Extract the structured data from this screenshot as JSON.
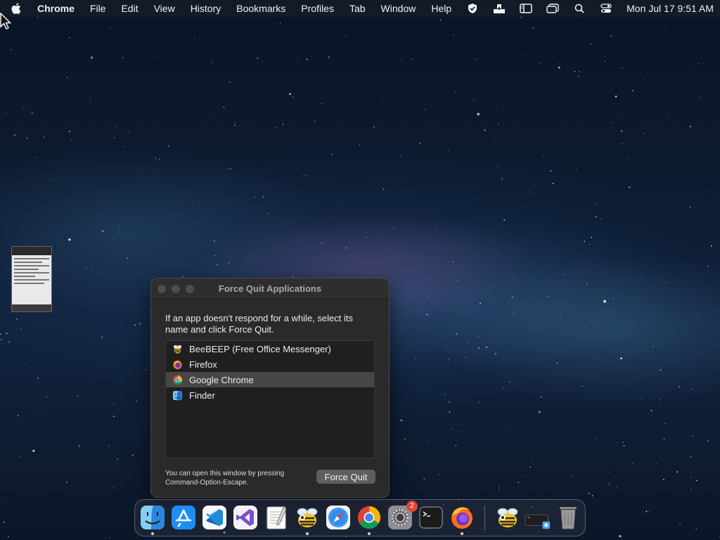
{
  "menubar": {
    "app_name": "Chrome",
    "items": [
      "File",
      "Edit",
      "View",
      "History",
      "Bookmarks",
      "Profiles",
      "Tab",
      "Window",
      "Help"
    ],
    "status_icons": [
      "vpn-shield-icon",
      "share-icon",
      "sidebar-icon",
      "window-overview-icon",
      "search-icon",
      "control-center-icon"
    ],
    "clock": "Mon Jul 17  9:51 AM"
  },
  "force_quit": {
    "title": "Force Quit Applications",
    "intro": "If an app doesn't respond for a while, select its name and click Force Quit.",
    "apps": [
      {
        "name": "BeeBEEP (Free Office Messenger)",
        "icon": "beebeep-icon",
        "selected": false
      },
      {
        "name": "Firefox",
        "icon": "firefox-icon",
        "selected": false
      },
      {
        "name": "Google Chrome",
        "icon": "chrome-icon",
        "selected": true
      },
      {
        "name": "Finder",
        "icon": "finder-icon",
        "selected": false
      }
    ],
    "hint": "You can open this window by pressing Command-Option-Escape.",
    "button": "Force Quit"
  },
  "dock": {
    "apps": [
      {
        "name": "Finder",
        "icon": "finder-icon",
        "running": true
      },
      {
        "name": "App Store",
        "icon": "app-store-icon",
        "running": false
      },
      {
        "name": "Visual Studio Code",
        "icon": "vscode-icon",
        "running": false
      },
      {
        "name": "Visual Studio",
        "icon": "visual-studio-icon",
        "running": false
      },
      {
        "name": "TextEdit",
        "icon": "textedit-icon",
        "running": false
      },
      {
        "name": "BeeBEEP",
        "icon": "beebeep-icon",
        "running": true
      },
      {
        "name": "Safari",
        "icon": "safari-icon",
        "running": false
      },
      {
        "name": "Google Chrome",
        "icon": "chrome-icon",
        "running": true
      },
      {
        "name": "System Preferences",
        "icon": "system-preferences-icon",
        "running": false,
        "badge": "2"
      },
      {
        "name": "Terminal",
        "icon": "terminal-icon",
        "running": false
      },
      {
        "name": "Firefox",
        "icon": "firefox-icon",
        "running": true
      }
    ],
    "others": [
      {
        "name": "BeeBEEP",
        "icon": "beebeep-icon"
      },
      {
        "name": "Downloads",
        "icon": "downloads-stack-icon"
      },
      {
        "name": "Trash",
        "icon": "trash-icon"
      }
    ]
  }
}
